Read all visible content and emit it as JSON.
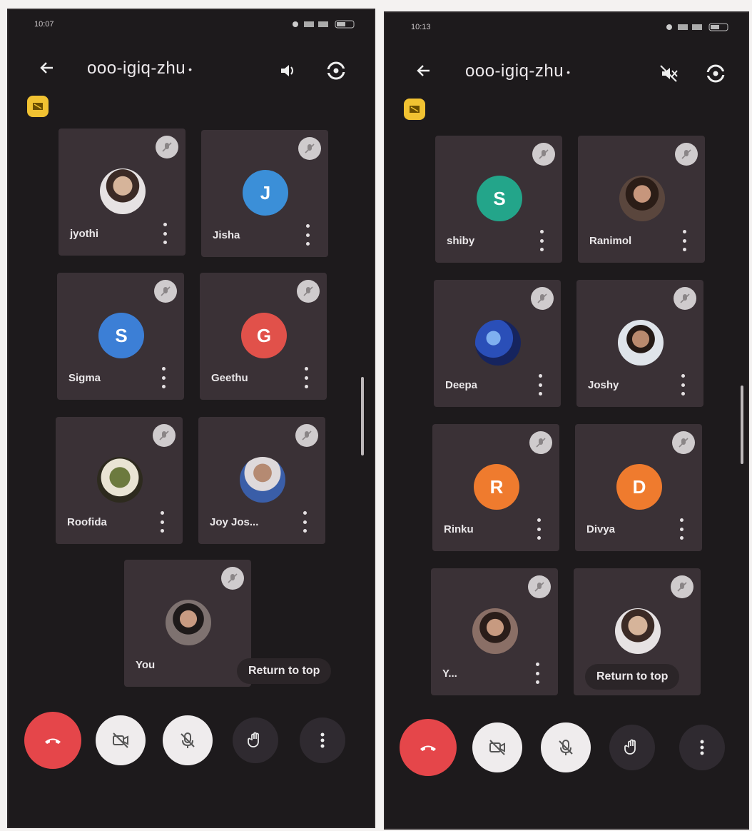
{
  "left": {
    "status_time": "10:07",
    "meeting_code": "ooo-igiq-zhu",
    "code_dot": "•",
    "return_to_top": "Return to top",
    "tiles": [
      {
        "name": "jyothi",
        "initial": "",
        "photo": true
      },
      {
        "name": "Jisha",
        "initial": "J",
        "color": "#3b8fd8"
      },
      {
        "name": "Sigma",
        "initial": "S",
        "color": "#3c7fd6"
      },
      {
        "name": "Geethu",
        "initial": "G",
        "color": "#e1514a"
      },
      {
        "name": "Roofida",
        "initial": "",
        "photo": true
      },
      {
        "name": "Joy Jos...",
        "initial": "",
        "photo": true
      },
      {
        "name": "You",
        "initial": "",
        "photo": true
      }
    ]
  },
  "right": {
    "status_time": "10:13",
    "meeting_code": "ooo-igiq-zhu",
    "code_dot": "•",
    "return_to_top": "Return to top",
    "tiles": [
      {
        "name": "shiby",
        "initial": "S",
        "color": "#23a58a"
      },
      {
        "name": "Ranimol",
        "initial": "",
        "photo": true
      },
      {
        "name": "Deepa",
        "initial": "",
        "photo": true
      },
      {
        "name": "Joshy",
        "initial": "",
        "photo": true
      },
      {
        "name": "Rinku",
        "initial": "R",
        "color": "#ef7b2e"
      },
      {
        "name": "Divya",
        "initial": "D",
        "color": "#ef7b2e"
      },
      {
        "name": "Y...",
        "initial": "",
        "photo": true
      },
      {
        "name": "",
        "initial": "",
        "photo": true
      }
    ]
  },
  "icons": {
    "back": "back-arrow-icon",
    "speaker": "speaker-icon",
    "speaker_off": "speaker-off-icon",
    "switch_camera": "switch-camera-icon",
    "present": "present-screen-icon",
    "mic_off": "mic-off-icon",
    "end_call": "end-call-icon",
    "camera_off": "camera-off-icon",
    "raise_hand": "raise-hand-icon",
    "more": "more-vertical-icon"
  },
  "colors": {
    "background": "#1d1a1c",
    "tile": "#3a3136",
    "end_call": "#e5464a",
    "present_chip": "#f1c232"
  }
}
